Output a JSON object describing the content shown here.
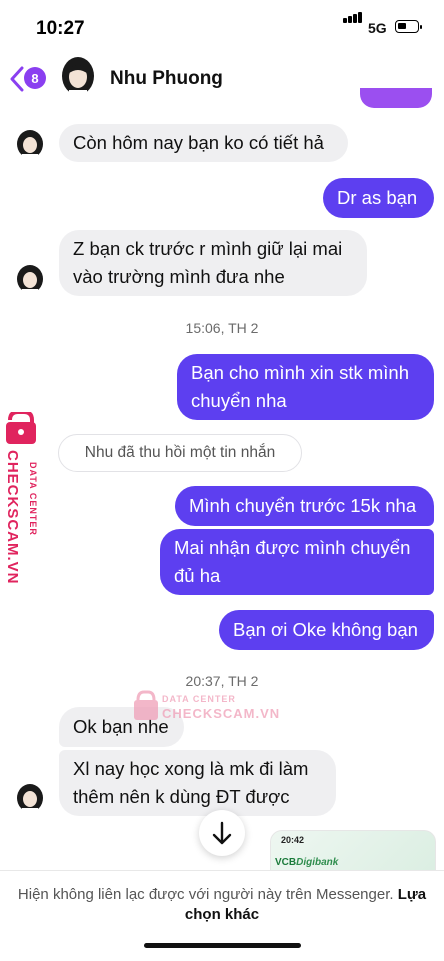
{
  "status_bar": {
    "time": "10:27",
    "network": "5G"
  },
  "header": {
    "unread_count": "8",
    "contact_name": "Nhu Phuong"
  },
  "messages": [
    {
      "text": "Còn hôm nay bạn ko có tiết hả"
    },
    {
      "text": "Dr as bạn"
    },
    {
      "text": "Z bạn ck trước r mình giữ lại mai vào trường mình đưa nhe"
    },
    {
      "text": "Bạn cho mình xin stk mình chuyển nha"
    },
    {
      "text": "Mình chuyển trước 15k nha"
    },
    {
      "text": "Mai nhận được mình chuyển đủ  ha"
    },
    {
      "text": "Bạn ơi Oke không bạn"
    },
    {
      "text": "Ok bạn nhe"
    },
    {
      "text": "Xl nay học xong là mk đi làm thêm nên k dùng ĐT được"
    }
  ],
  "timestamps": [
    "15:06, TH 2",
    "20:37, TH 2"
  ],
  "recalled_notice": "Nhu đã thu hồi một tin nhắn",
  "watermark": {
    "label": "DATA CENTER",
    "brand": "CHECKSCAM.VN",
    "color": "#e0245e"
  },
  "thumbnail": {
    "time": "20:42",
    "bank": "VCB",
    "bank_suffix": "Digibank"
  },
  "footer": {
    "notice": "Hiện không liên lạc được với người này trên Messenger.",
    "action": "Lựa chọn khác"
  },
  "colors": {
    "outgoing": "#5d3ff0",
    "incoming": "#efeff1",
    "accent": "#8a3ff0"
  }
}
